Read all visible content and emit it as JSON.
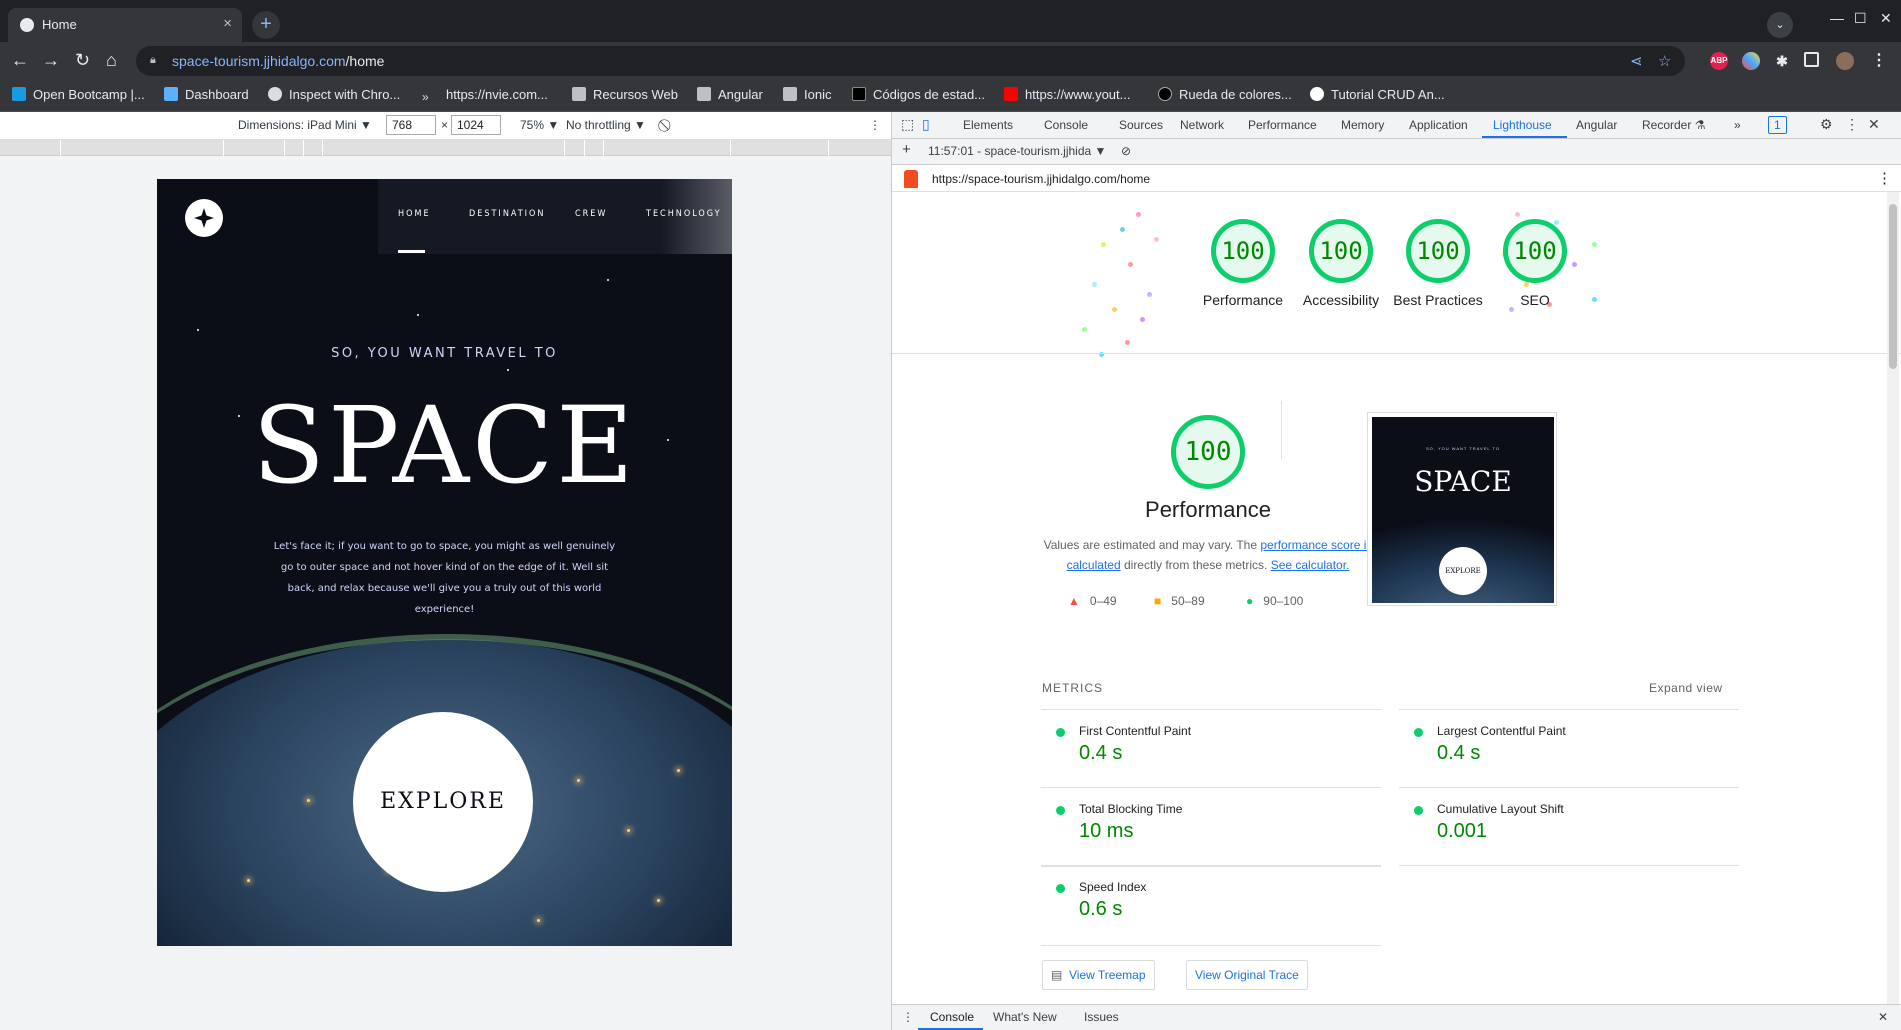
{
  "browser": {
    "tab_title": "Home",
    "new_tab_label": "+",
    "url_host": "space-tourism.jjhidalgo.com",
    "url_path": "/home",
    "bookmarks": [
      "Open Bootcamp |...",
      "Dashboard",
      "Inspect with Chro...",
      "https://nvie.com...",
      "Recursos Web",
      "Angular",
      "Ionic",
      "Códigos de estad...",
      "https://www.yout...",
      "Rueda de colores...",
      "Tutorial CRUD An..."
    ]
  },
  "device_toolbar": {
    "dimensions_label": "Dimensions: iPad Mini ▼",
    "width": "768",
    "times": "×",
    "height": "1024",
    "zoom": "75% ▼",
    "throttling": "No throttling ▼"
  },
  "site": {
    "nav": [
      "HOME",
      "DESTINATION",
      "CREW",
      "TECHNOLOGY"
    ],
    "kicker": "SO, YOU WANT TRAVEL TO",
    "headline": "SPACE",
    "paragraph": "Let's face it; if you want to go to space, you might as well genuinely go to outer space and not hover kind of on the edge of it. Well sit back, and relax because we'll give you a truly out of this world experience!",
    "explore": "EXPLORE"
  },
  "devtools": {
    "tabs": [
      "Elements",
      "Console",
      "Sources",
      "Network",
      "Performance",
      "Memory",
      "Application",
      "Lighthouse",
      "Angular",
      "Recorder ⚗"
    ],
    "active_tab": "Lighthouse",
    "issues_badge": "1",
    "report_selector": "11:57:01 - space-tourism.jjhida ▼",
    "report_url": "https://space-tourism.jjhidalgo.com/home",
    "scores": [
      {
        "value": "100",
        "label": "Performance"
      },
      {
        "value": "100",
        "label": "Accessibility"
      },
      {
        "value": "100",
        "label": "Best Practices"
      },
      {
        "value": "100",
        "label": "SEO"
      }
    ],
    "perf_score": "100",
    "perf_title": "Performance",
    "perf_desc_1": "Values are estimated and may vary. The ",
    "perf_desc_link1": "performance score is calculated",
    "perf_desc_2": " directly from these metrics. ",
    "perf_desc_link2": "See calculator.",
    "legend": [
      "0–49",
      "50–89",
      "90–100"
    ],
    "thumb_headline": "SPACE",
    "thumb_kicker": "SO, YOU WANT TRAVEL TO",
    "thumb_explore": "EXPLORE",
    "metrics_header": "METRICS",
    "expand_view": "Expand view",
    "metrics": [
      {
        "name": "First Contentful Paint",
        "value": "0.4 s"
      },
      {
        "name": "Largest Contentful Paint",
        "value": "0.4 s"
      },
      {
        "name": "Total Blocking Time",
        "value": "10 ms"
      },
      {
        "name": "Cumulative Layout Shift",
        "value": "0.001"
      },
      {
        "name": "Speed Index",
        "value": "0.6 s"
      }
    ],
    "view_treemap": "View Treemap",
    "view_trace": "View Original Trace",
    "drawer_tabs": [
      "Console",
      "What's New",
      "Issues"
    ],
    "colors": {
      "pass": "#0cce6b",
      "average": "#ffa400",
      "fail": "#ff4e42",
      "accent": "#1a73e8"
    }
  }
}
